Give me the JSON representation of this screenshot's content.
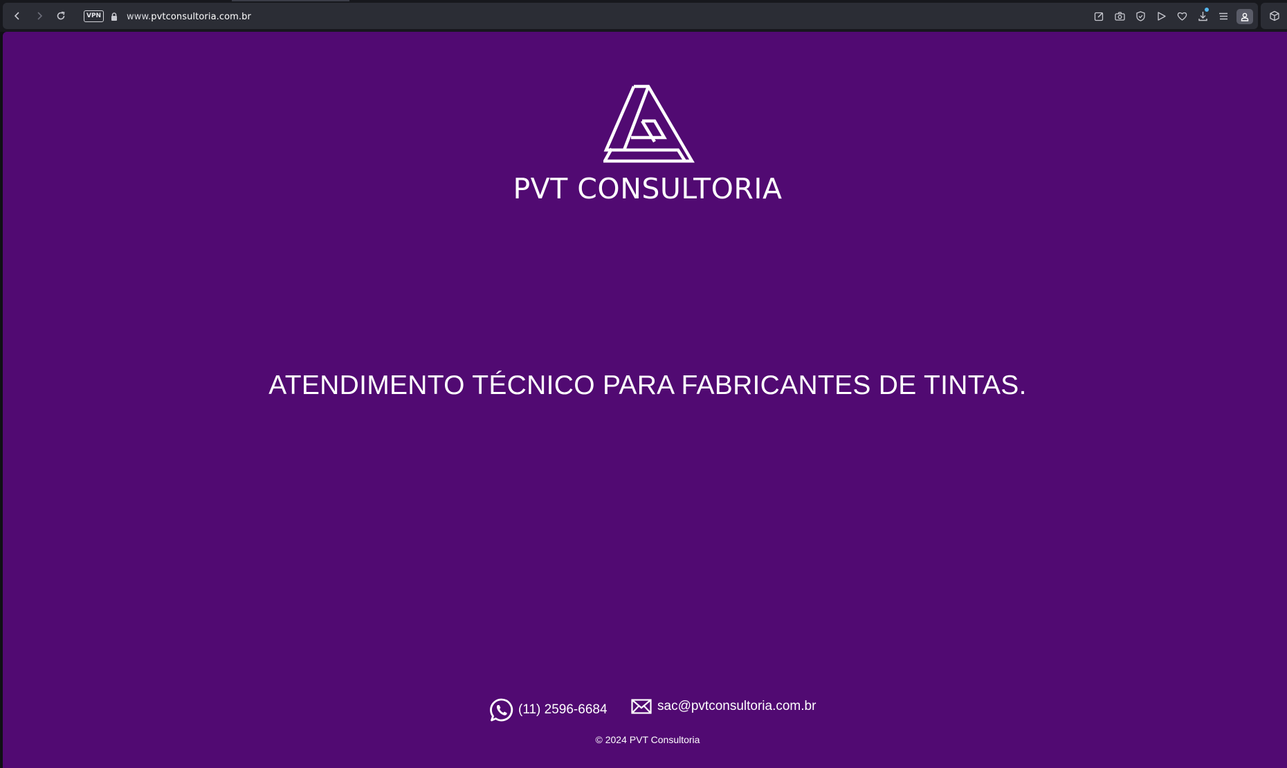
{
  "browser": {
    "url_prefix": "www.",
    "url_host": "pvtconsultoria.com.br",
    "vpn_label": "VPN",
    "icons": {
      "back": "chevron-left-icon",
      "forward": "chevron-right-icon",
      "reload": "reload-icon",
      "lock": "lock-icon",
      "edit": "edit-icon",
      "snapshot": "camera-icon",
      "shield": "shield-icon",
      "play": "play-icon",
      "heart": "heart-icon",
      "download": "download-icon",
      "menu": "menu-icon",
      "profile": "profile-icon",
      "extensions": "cube-icon"
    }
  },
  "page": {
    "background_color": "#510a72",
    "brand_name": "PVT CONSULTORIA",
    "headline": "ATENDIMENTO TÉCNICO PARA FABRICANTES DE TINTAS.",
    "contact": {
      "phone": "(11) 2596-6684",
      "email": "sac@pvtconsultoria.com.br"
    },
    "copyright": "© 2024 PVT Consultoria"
  }
}
